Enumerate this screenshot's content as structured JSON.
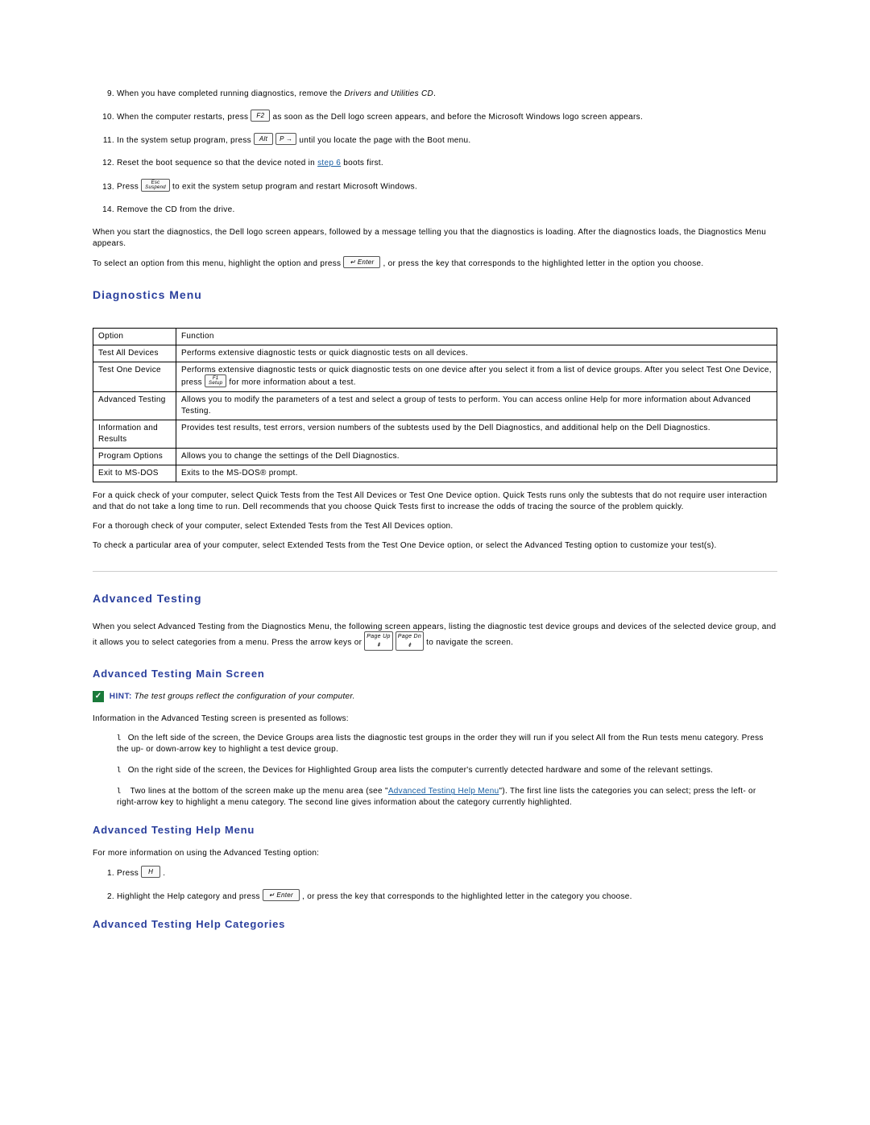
{
  "steps_top": {
    "s9_a": "When you have completed running diagnostics, remove the ",
    "s9_i": "Drivers and Utilities CD",
    "s9_b": ".",
    "s10_a": "When the computer restarts, press ",
    "s10_key": "F2",
    "s10_b": " as soon as the Dell logo screen appears, and before the Microsoft Windows logo screen appears.",
    "s11_a": "In the system setup program, press ",
    "s11_k1": "Alt",
    "s11_k2": "P →",
    "s11_b": " until you locate the page with the Boot menu.",
    "s12_a": "Reset the boot sequence so that the device noted in ",
    "s12_link": "step 6",
    "s12_b": " boots first.",
    "s13_a": "Press ",
    "s13_k": "Esc\nSuspend",
    "s13_b": " to exit the system setup program and restart Microsoft Windows.",
    "s14": "Remove the CD from the drive."
  },
  "para1": "When you start the diagnostics, the Dell logo screen appears, followed by a message telling you that the diagnostics is loading. After the diagnostics loads, the Diagnostics Menu appears.",
  "para2_a": "To select an option from this menu, highlight the option and press ",
  "para2_key": "↵  Enter",
  "para2_b": " , or press the key that corresponds to the highlighted letter in the option you choose.",
  "h_diag_menu": "Diagnostics Menu",
  "table": {
    "head_opt": "Option",
    "head_fn": "Function",
    "rows": [
      {
        "opt": "Test All Devices",
        "fn_a": "Performs extensive diagnostic tests or quick diagnostic tests on all devices.",
        "key": "",
        "fn_b": ""
      },
      {
        "opt": "Test One Device",
        "fn_a": "Performs extensive diagnostic tests or quick diagnostic tests on one device after you select it from a list of device groups. After you select Test One Device, press ",
        "key": "F1\nSetup",
        "fn_b": " for more information about a test."
      },
      {
        "opt": "Advanced Testing",
        "fn_a": "Allows you to modify the parameters of a test and select a group of tests to perform. You can access online Help for more information about Advanced Testing.",
        "key": "",
        "fn_b": ""
      },
      {
        "opt": "Information and Results",
        "fn_a": "Provides test results, test errors, version numbers of the subtests used by the Dell Diagnostics, and additional help on the Dell Diagnostics.",
        "key": "",
        "fn_b": ""
      },
      {
        "opt": "Program Options",
        "fn_a": "Allows you to change the settings of the Dell Diagnostics.",
        "key": "",
        "fn_b": ""
      },
      {
        "opt": "Exit to MS-DOS",
        "fn_a": "Exits to the MS-DOS® prompt.",
        "key": "",
        "fn_b": ""
      }
    ]
  },
  "para3": "For a quick check of your computer, select Quick Tests from the Test All Devices or Test One Device option. Quick Tests runs only the subtests that do not require user interaction and that do not take a long time to run. Dell recommends that you choose Quick Tests first to increase the odds of tracing the source of the problem quickly.",
  "para4": "For a thorough check of your computer, select Extended Tests from the Test All Devices option.",
  "para5": "To check a particular area of your computer, select Extended Tests from the Test One Device option, or select the Advanced Testing option to customize your test(s).",
  "h_adv_test": "Advanced Testing",
  "para6_a": "When you select Advanced Testing from the Diagnostics Menu, the following screen appears, listing the diagnostic test device groups and devices of the selected device group, and it allows you to select categories from a menu. Press the arrow keys or ",
  "para6_k1": "Page Up",
  "para6_k2": "Page Dn",
  "para6_b": " to navigate the screen.",
  "h_adv_main": "Advanced Testing Main Screen",
  "hint_label": "HINT:",
  "hint_text": " The test groups reflect the configuration of your computer.",
  "para7": "Information in the Advanced Testing screen is presented as follows:",
  "bullets": {
    "b1": "On the left side of the screen, the Device Groups area lists the diagnostic test groups in the order they will run if you select All from the Run tests menu category. Press the up- or down-arrow key to highlight a test device group.",
    "b2": "On the right side of the screen, the Devices for Highlighted Group area lists the computer's currently detected hardware and some of the relevant settings.",
    "b3_a": "Two lines at the bottom of the screen make up the menu area (see \"",
    "b3_link": "Advanced Testing Help Menu",
    "b3_b": "\"). The first line lists the categories you can select; press the left- or right-arrow key to highlight a menu category. The second line gives information about the category currently highlighted."
  },
  "h_adv_help": "Advanced Testing Help Menu",
  "para8": "For more information on using the Advanced Testing option:",
  "help_steps": {
    "s1_a": "Press ",
    "s1_key": "H",
    "s1_b": " .",
    "s2_a": "Highlight the Help category and press ",
    "s2_key": "↵  Enter",
    "s2_b": " , or press the key that corresponds to the highlighted letter in the category you choose."
  },
  "h_adv_cat": "Advanced Testing Help Categories"
}
